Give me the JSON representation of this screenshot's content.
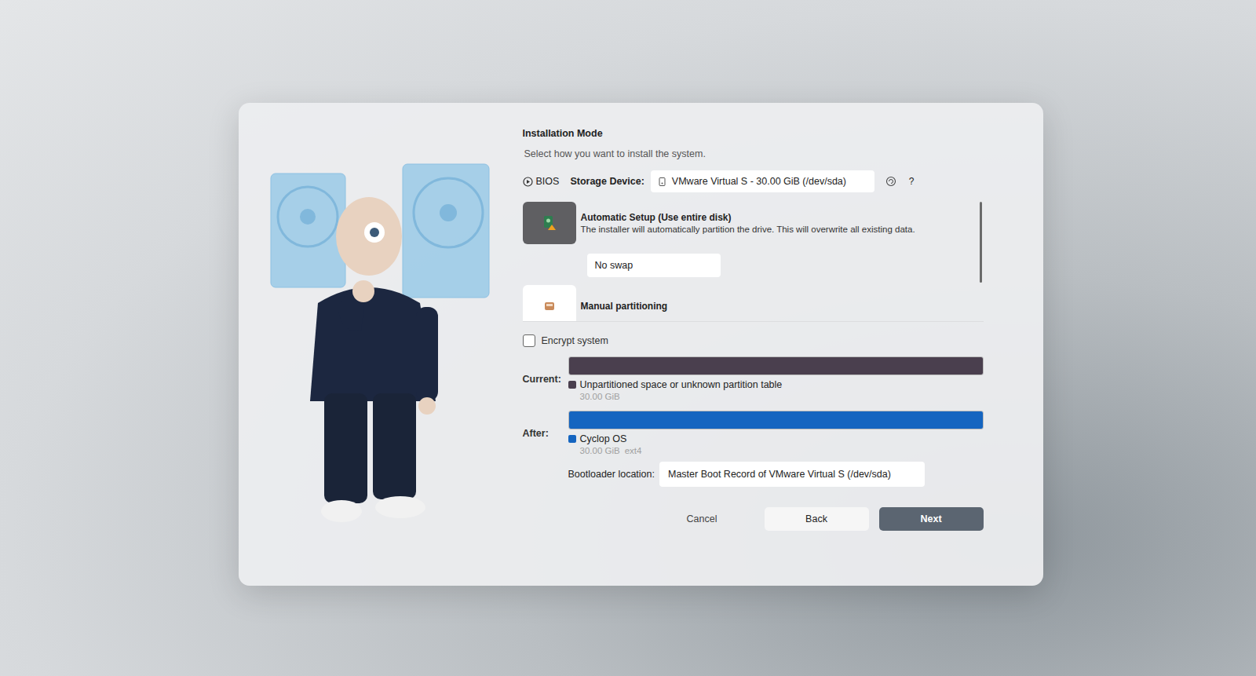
{
  "dialog": {
    "title": "Installation Mode",
    "subtitle": "Select how you want to install the system."
  },
  "firmware": "BIOS",
  "storage": {
    "label": "Storage Device:",
    "value": "VMware Virtual S - 30.00 GiB (/dev/sda)",
    "help": "?"
  },
  "options": [
    {
      "title": "Automatic Setup (Use entire disk)",
      "description": "The installer will automatically partition the drive. This will overwrite all existing data.",
      "selected": true,
      "swap": "No swap"
    },
    {
      "title": "Manual partitioning",
      "description": "",
      "selected": false,
      "swap": ""
    }
  ],
  "encrypt": {
    "label": "Encrypt system",
    "checked": false
  },
  "layouts": [
    {
      "label": "Current:",
      "partitions": [
        {
          "name": "Unpartitioned space or unknown partition table",
          "size": "30.00 GiB",
          "fs": "",
          "color": "#4a3f4e",
          "level": 1
        }
      ]
    },
    {
      "label": "After:",
      "partitions": [
        {
          "name": "Cyclop OS",
          "size": "30.00 GiB",
          "fs": "ext4",
          "color": "#1565c0",
          "level": 1
        }
      ]
    }
  ],
  "bootloader": {
    "label": "Bootloader location:",
    "value": "Master Boot Record of VMware Virtual S (/dev/sda)"
  },
  "buttons": [
    {
      "label": "Cancel",
      "kind": "text"
    },
    {
      "label": "Back",
      "kind": "secondary"
    },
    {
      "label": "Next",
      "kind": "primary"
    }
  ]
}
